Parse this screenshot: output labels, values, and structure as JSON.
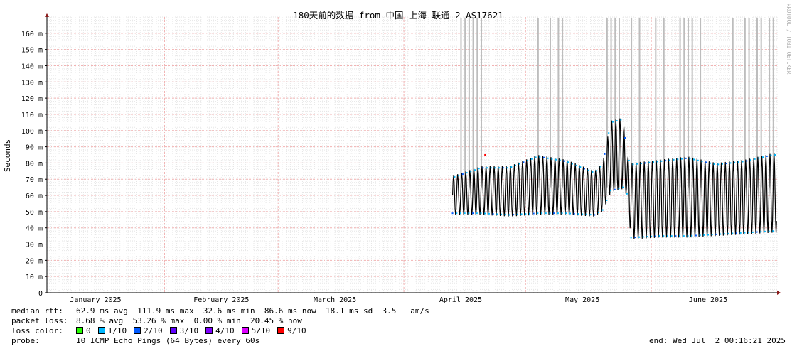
{
  "chart_data": {
    "type": "line",
    "title": "180天前的数据 from 中国 上海 联通-2 AS17621",
    "ylabel": "Seconds",
    "ylim": [
      0,
      0.17
    ],
    "yticks": [
      {
        "value": 0,
        "label": "0"
      },
      {
        "value": 0.01,
        "label": "10 m"
      },
      {
        "value": 0.02,
        "label": "20 m"
      },
      {
        "value": 0.03,
        "label": "30 m"
      },
      {
        "value": 0.04,
        "label": "40 m"
      },
      {
        "value": 0.05,
        "label": "50 m"
      },
      {
        "value": 0.06,
        "label": "60 m"
      },
      {
        "value": 0.07,
        "label": "70 m"
      },
      {
        "value": 0.08,
        "label": "80 m"
      },
      {
        "value": 0.09,
        "label": "90 m"
      },
      {
        "value": 0.1,
        "label": "100 m"
      },
      {
        "value": 0.11,
        "label": "110 m"
      },
      {
        "value": 0.12,
        "label": "120 m"
      },
      {
        "value": 0.13,
        "label": "130 m"
      },
      {
        "value": 0.14,
        "label": "140 m"
      },
      {
        "value": 0.15,
        "label": "150 m"
      },
      {
        "value": 0.16,
        "label": "160 m"
      }
    ],
    "xlim": [
      "2025-01-03",
      "2025-07-02"
    ],
    "xticks": [
      {
        "date": "2025-01-15",
        "label": "January 2025"
      },
      {
        "date": "2025-02-15",
        "label": "February 2025"
      },
      {
        "date": "2025-03-15",
        "label": "March 2025"
      },
      {
        "date": "2025-04-15",
        "label": "April 2025"
      },
      {
        "date": "2025-05-15",
        "label": "May 2025"
      },
      {
        "date": "2025-06-15",
        "label": "June 2025"
      }
    ],
    "grid": true,
    "watermark": "RRDTOOL / TOBI OETIKER",
    "data_start": "2025-04-13",
    "median_series": [
      [
        "2025-04-13",
        0.055
      ],
      [
        "2025-04-15",
        0.058
      ],
      [
        "2025-04-17",
        0.055
      ],
      [
        "2025-04-19",
        0.056
      ],
      [
        "2025-04-21",
        0.057
      ],
      [
        "2025-04-23",
        0.056
      ],
      [
        "2025-04-25",
        0.055
      ],
      [
        "2025-04-27",
        0.056
      ],
      [
        "2025-04-29",
        0.058
      ],
      [
        "2025-05-01",
        0.062
      ],
      [
        "2025-05-03",
        0.066
      ],
      [
        "2025-05-05",
        0.062
      ],
      [
        "2025-05-07",
        0.06
      ],
      [
        "2025-05-09",
        0.062
      ],
      [
        "2025-05-11",
        0.064
      ],
      [
        "2025-05-13",
        0.06
      ],
      [
        "2025-05-15",
        0.056
      ],
      [
        "2025-05-17",
        0.058
      ],
      [
        "2025-05-19",
        0.06
      ],
      [
        "2025-05-21",
        0.072
      ],
      [
        "2025-05-23",
        0.078
      ],
      [
        "2025-05-25",
        0.08
      ],
      [
        "2025-05-26",
        0.076
      ],
      [
        "2025-05-27",
        0.05
      ],
      [
        "2025-05-29",
        0.052
      ],
      [
        "2025-05-31",
        0.055
      ],
      [
        "2025-06-02",
        0.057
      ],
      [
        "2025-06-04",
        0.055
      ],
      [
        "2025-06-06",
        0.058
      ],
      [
        "2025-06-08",
        0.06
      ],
      [
        "2025-06-10",
        0.062
      ],
      [
        "2025-06-12",
        0.06
      ],
      [
        "2025-06-14",
        0.058
      ],
      [
        "2025-06-16",
        0.057
      ],
      [
        "2025-06-18",
        0.058
      ],
      [
        "2025-06-20",
        0.06
      ],
      [
        "2025-06-22",
        0.059
      ],
      [
        "2025-06-24",
        0.058
      ],
      [
        "2025-06-26",
        0.06
      ],
      [
        "2025-06-28",
        0.062
      ],
      [
        "2025-06-30",
        0.063
      ],
      [
        "2025-07-01",
        0.064
      ]
    ],
    "daily_swing": [
      [
        "2025-04-13",
        0.048,
        0.072
      ],
      [
        "2025-04-20",
        0.048,
        0.078
      ],
      [
        "2025-04-27",
        0.047,
        0.078
      ],
      [
        "2025-05-04",
        0.048,
        0.085
      ],
      [
        "2025-05-11",
        0.048,
        0.082
      ],
      [
        "2025-05-18",
        0.047,
        0.075
      ],
      [
        "2025-05-20",
        0.05,
        0.08
      ],
      [
        "2025-05-22",
        0.062,
        0.106
      ],
      [
        "2025-05-25",
        0.064,
        0.108
      ],
      [
        "2025-05-26",
        0.06,
        0.085
      ],
      [
        "2025-05-27",
        0.033,
        0.08
      ],
      [
        "2025-06-03",
        0.034,
        0.082
      ],
      [
        "2025-06-10",
        0.034,
        0.084
      ],
      [
        "2025-06-17",
        0.035,
        0.08
      ],
      [
        "2025-06-24",
        0.036,
        0.082
      ],
      [
        "2025-07-01",
        0.037,
        0.086
      ]
    ],
    "loss_spike_dates": [
      "2025-04-15",
      "2025-04-16",
      "2025-04-17",
      "2025-04-18",
      "2025-04-19",
      "2025-04-20",
      "2025-05-04",
      "2025-05-07",
      "2025-05-09",
      "2025-05-10",
      "2025-05-21",
      "2025-05-22",
      "2025-05-23",
      "2025-05-24",
      "2025-05-27",
      "2025-05-29",
      "2025-06-02",
      "2025-06-04",
      "2025-06-08",
      "2025-06-09",
      "2025-06-10",
      "2025-06-11",
      "2025-06-13",
      "2025-06-21",
      "2025-06-24",
      "2025-06-25",
      "2025-06-27",
      "2025-06-28",
      "2025-06-30",
      "2025-07-01"
    ]
  },
  "stats": {
    "median_rtt": {
      "label": "median rtt:",
      "text": "62.9 ms avg  111.9 ms max  32.6 ms min  86.6 ms now  18.1 ms sd  3.5   am/s"
    },
    "packet_loss": {
      "label": "packet loss:",
      "text": "8.68 % avg  53.26 % max  0.00 % min  20.45 % now"
    },
    "loss_color": {
      "label": "loss color:",
      "items": [
        {
          "label": "0",
          "color": "#26ff00"
        },
        {
          "label": "1/10",
          "color": "#00b8ff"
        },
        {
          "label": "2/10",
          "color": "#0059ff"
        },
        {
          "label": "3/10",
          "color": "#5e00ff"
        },
        {
          "label": "4/10",
          "color": "#7e00ff"
        },
        {
          "label": "5/10",
          "color": "#dd00ff"
        },
        {
          "label": "9/10",
          "color": "#ff0000"
        }
      ]
    },
    "probe": {
      "label": "probe:",
      "text": "10 ICMP Echo Pings (64 Bytes) every 60s"
    },
    "end": "end: Wed Jul  2 00:16:21 2025"
  },
  "colors": {
    "minor_grid": "#e6e6e6",
    "major_grid": "#f2b3b3",
    "axis": "#000000",
    "arrow": "#8b1a1a",
    "smoke": "#bdbdbd",
    "median": "#000000"
  }
}
